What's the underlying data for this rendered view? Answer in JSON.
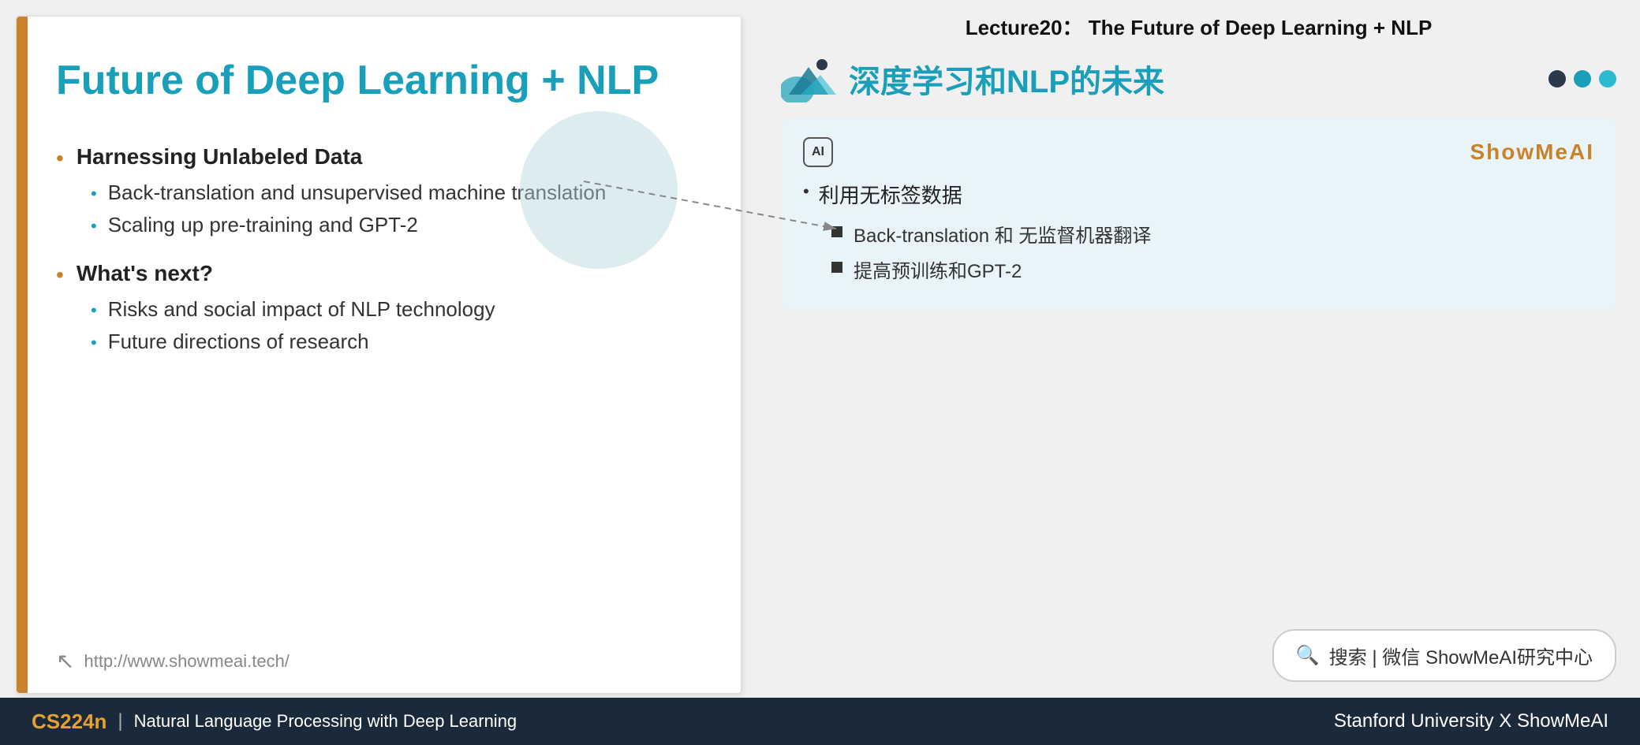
{
  "slide": {
    "title": "Future of Deep Learning + NLP",
    "left_bar_color": "#c8832a",
    "bullets": [
      {
        "main": "Harnessing Unlabeled Data",
        "sub": [
          "Back-translation and unsupervised machine translation",
          "Scaling up pre-training and GPT-2"
        ]
      },
      {
        "main": "What's next?",
        "sub": [
          "Risks and social impact of NLP technology",
          "Future directions of research"
        ]
      }
    ],
    "footer_url": "http://www.showmeai.tech/"
  },
  "right_panel": {
    "lecture_title": "Lecture20： The Future of Deep Learning + NLP",
    "chinese_title": "深度学习和NLP的未来",
    "nav_dots": [
      "dark",
      "teal",
      "teal2"
    ],
    "translation_card": {
      "brand": "ShowMeAI",
      "main_bullet": "利用无标签数据",
      "sub_bullets": [
        "Back-translation 和 无监督机器翻译",
        "提高预训练和GPT-2"
      ]
    },
    "search": {
      "text": "搜索 | 微信 ShowMeAI研究中心"
    }
  },
  "bottom_bar": {
    "course_code": "CS224n",
    "separator": "|",
    "course_name": "Natural Language Processing with Deep Learning",
    "right_text": "Stanford University  X  ShowMeAI"
  }
}
